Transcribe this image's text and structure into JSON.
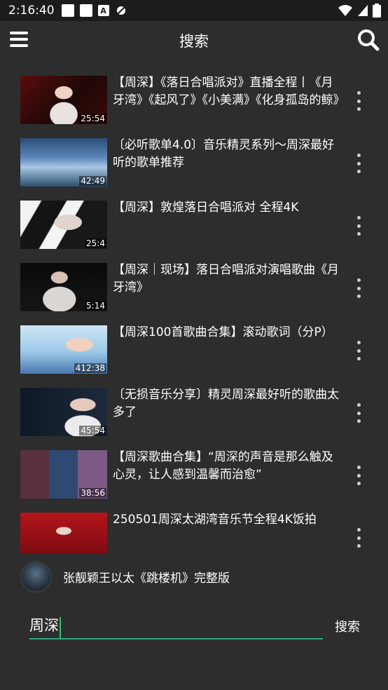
{
  "status_bar": {
    "time": "2:16:40",
    "a_icon_text": "A"
  },
  "header": {
    "title": "搜索"
  },
  "videos": [
    {
      "title": "【周深】《落日合唱派对》直播全程丨《月牙湾》《起风了》《小美满》《化身孤岛的鲸》",
      "duration": "25:54",
      "thumb_theme": "stage-red"
    },
    {
      "title": "〔必听歌单4.0〕音乐精灵系列～周深最好听的歌单推荐",
      "duration": "42:49",
      "thumb_theme": "blue-sky"
    },
    {
      "title": "【周深】敦煌落日合唱派对 全程4K",
      "duration": "25:4",
      "thumb_theme": "white-stage"
    },
    {
      "title": "【周深｜现场】落日合唱派对演唱歌曲《月牙湾》",
      "duration": "5:14",
      "thumb_theme": "dark-stage"
    },
    {
      "title": "【周深100首歌曲合集】滚动歌词（分P）",
      "duration": "412:38",
      "thumb_theme": "blue-poster"
    },
    {
      "title": "〔无损音乐分享〕精灵周深最好听的歌曲太多了",
      "duration": "45:54",
      "thumb_theme": "dark-list"
    },
    {
      "title": "【周深歌曲合集】“周深的声音是那么触及心灵，让人感到温馨而治愈”",
      "duration": "38:56",
      "thumb_theme": "collage"
    },
    {
      "title": "250501周深太湖湾音乐节全程4K饭拍",
      "duration": "",
      "thumb_theme": "festival-red"
    }
  ],
  "suggestion": {
    "text": "张靓颖王以太《跳楼机》完整版"
  },
  "search": {
    "value": "周深",
    "submit_label": "搜索"
  },
  "colors": {
    "background": "#2d2d2d",
    "status_bar": "#1c1c1c",
    "accent": "#2fa87a"
  }
}
